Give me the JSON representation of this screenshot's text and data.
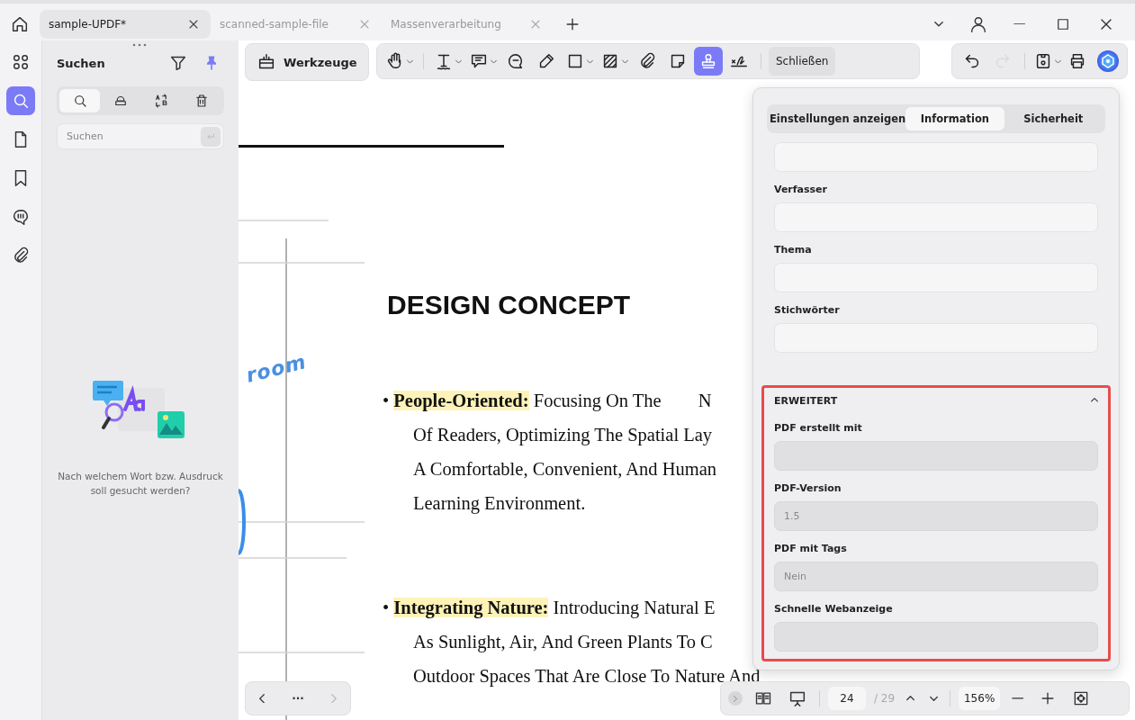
{
  "tabs": [
    {
      "label": "sample-UPDF*",
      "selected": true
    },
    {
      "label": "scanned-sample-file",
      "selected": false
    },
    {
      "label": "Massenverarbeitung",
      "selected": false
    }
  ],
  "rail": [
    {
      "kind": "grid",
      "selected": false
    },
    {
      "kind": "search",
      "selected": true
    },
    {
      "kind": "page",
      "selected": false
    },
    {
      "kind": "bookmark",
      "selected": false
    },
    {
      "kind": "comment",
      "selected": false
    },
    {
      "kind": "clip",
      "selected": false
    }
  ],
  "search_panel": {
    "title": "Suchen",
    "pinned": true,
    "modes": [
      {
        "kind": "search",
        "selected": true
      },
      {
        "kind": "redact",
        "selected": false
      },
      {
        "kind": "replace",
        "selected": false
      },
      {
        "kind": "trash",
        "selected": false
      }
    ],
    "field": {
      "placeholder": "Suchen"
    },
    "hint": "Nach welchem Wort bzw. Ausdruck soll gesucht werden?"
  },
  "tools_button": "Werkzeuge",
  "tools": [
    {
      "kind": "hand",
      "dropdown": true,
      "selected": false,
      "separator_after": true
    },
    {
      "kind": "text",
      "dropdown": true,
      "selected": false,
      "separator_after": false
    },
    {
      "kind": "note",
      "dropdown": true,
      "selected": false,
      "separator_after": false
    },
    {
      "kind": "chat",
      "dropdown": false,
      "selected": false,
      "separator_after": false
    },
    {
      "kind": "pen",
      "dropdown": false,
      "selected": false,
      "separator_after": false
    },
    {
      "kind": "rect",
      "dropdown": true,
      "selected": false,
      "separator_after": false
    },
    {
      "kind": "hatch",
      "dropdown": true,
      "selected": false,
      "separator_after": false
    },
    {
      "kind": "clip",
      "dropdown": false,
      "selected": false,
      "separator_after": false
    },
    {
      "kind": "sticky",
      "dropdown": false,
      "selected": false,
      "separator_after": false
    },
    {
      "kind": "stamp",
      "dropdown": false,
      "selected": true,
      "separator_after": false
    },
    {
      "kind": "sign",
      "dropdown": false,
      "selected": false,
      "separator_after": true
    }
  ],
  "close_tool": "Schließen",
  "actions": [
    {
      "kind": "undo",
      "disabled": false,
      "dropdown": false
    },
    {
      "kind": "redo",
      "disabled": true,
      "dropdown": false
    },
    {
      "kind": "save",
      "disabled": false,
      "dropdown": true
    },
    {
      "kind": "print",
      "disabled": false,
      "dropdown": false
    },
    {
      "kind": "ai",
      "disabled": false
    }
  ],
  "document": {
    "heading": "DESIGN CONCEPT",
    "margin_note": "room",
    "paragraphs": [
      {
        "bullet": "•",
        "lead": "People-Oriented:",
        "highlighted": true,
        "lines": [
          "Focusing On The        N",
          "Of Readers, Optimizing The Spatial Lay",
          "A Comfortable, Convenient, And Human",
          "Learning Environment."
        ]
      },
      {
        "bullet": "•",
        "lead": "Integrating Nature:",
        "highlighted": true,
        "lines": [
          "Introducing Natural E",
          "As Sunlight, Air, And Green Plants To C",
          "Outdoor Spaces That Are Close To Nature And"
        ]
      }
    ]
  },
  "properties": {
    "tabs": [
      {
        "label": "Einstellungen anzeigen",
        "selected": false
      },
      {
        "label": "Information",
        "selected": true
      },
      {
        "label": "Sicherheit",
        "selected": false
      }
    ],
    "fields": [
      {
        "disabled": false
      },
      {
        "label": "Verfasser",
        "disabled": false
      },
      {
        "label": "Thema",
        "disabled": false
      },
      {
        "label": "Stichwörter",
        "disabled": false
      }
    ],
    "advanced": {
      "title": "ERWEITERT",
      "expanded": true,
      "fields": [
        {
          "label": "PDF erstellt mit",
          "disabled": true
        },
        {
          "label": "PDF-Version",
          "value": "1.5",
          "disabled": true
        },
        {
          "label": "PDF mit Tags",
          "value": "Nein",
          "disabled": true
        },
        {
          "label": "Schnelle Webanzeige",
          "disabled": true
        }
      ]
    }
  },
  "page_nav": {
    "more": "···"
  },
  "status": {
    "page": "24",
    "total": "/ 29",
    "zoom": "156%"
  }
}
